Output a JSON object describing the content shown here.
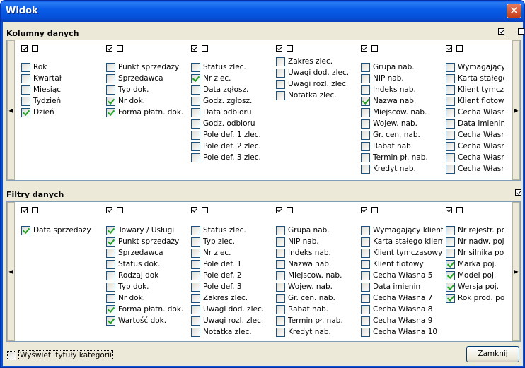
{
  "window": {
    "title": "Widok",
    "close_glyph": "✕"
  },
  "columns_section": {
    "title": "Kolumny danych",
    "header_checks": [
      true,
      false
    ],
    "columns": [
      {
        "header": [
          true,
          false
        ],
        "items": [
          {
            "label": "Rok",
            "checked": false
          },
          {
            "label": "Kwartał",
            "checked": false
          },
          {
            "label": "Miesiąc",
            "checked": false
          },
          {
            "label": "Tydzień",
            "checked": false
          },
          {
            "label": "Dzień",
            "checked": true
          }
        ]
      },
      {
        "header": [
          true,
          false
        ],
        "items": [
          {
            "label": "Punkt sprzedaży",
            "checked": false
          },
          {
            "label": "Sprzedawca",
            "checked": false
          },
          {
            "label": "Typ dok.",
            "checked": false
          },
          {
            "label": "Nr dok.",
            "checked": true
          },
          {
            "label": "Forma płatn. dok.",
            "checked": true
          }
        ]
      },
      {
        "header": [
          true,
          false
        ],
        "items": [
          {
            "label": "Status zlec.",
            "checked": false
          },
          {
            "label": "Nr zlec.",
            "checked": true
          },
          {
            "label": "Data zgłosz.",
            "checked": false
          },
          {
            "label": "Godz. zgłosz.",
            "checked": false
          },
          {
            "label": "Data odbioru",
            "checked": false
          },
          {
            "label": "Godz. odbioru",
            "checked": false
          },
          {
            "label": "Pole def. 1 zlec.",
            "checked": false
          },
          {
            "label": "Pole def. 2 zlec.",
            "checked": false
          },
          {
            "label": "Pole def. 3 zlec.",
            "checked": false
          }
        ]
      },
      {
        "header": [
          true,
          false
        ],
        "items": [
          {
            "label": "Zakres zlec.",
            "checked": false
          },
          {
            "label": "Uwagi dod. zlec.",
            "checked": false
          },
          {
            "label": "Uwagi rozl. zlec.",
            "checked": false
          },
          {
            "label": "Notatka zlec.",
            "checked": false
          }
        ]
      },
      {
        "header": [
          true,
          false
        ],
        "items": [
          {
            "label": "Grupa nab.",
            "checked": false
          },
          {
            "label": "NIP nab.",
            "checked": false
          },
          {
            "label": "Indeks nab.",
            "checked": false
          },
          {
            "label": "Nazwa nab.",
            "checked": true
          },
          {
            "label": "Miejscow. nab.",
            "checked": false
          },
          {
            "label": "Wojew. nab.",
            "checked": false
          },
          {
            "label": "Gr. cen. nab.",
            "checked": false
          },
          {
            "label": "Rabat nab.",
            "checked": false
          },
          {
            "label": "Termin pł. nab.",
            "checked": false
          },
          {
            "label": "Kredyt nab.",
            "checked": false
          }
        ]
      },
      {
        "header": [
          true,
          false
        ],
        "items": [
          {
            "label": "Wymagający kli",
            "checked": false
          },
          {
            "label": "Karta stałego kl",
            "checked": false
          },
          {
            "label": "Klient tymczaso",
            "checked": false
          },
          {
            "label": "Klient flotowy",
            "checked": false
          },
          {
            "label": "Cecha Własna",
            "checked": false
          },
          {
            "label": "Data imienin",
            "checked": false
          },
          {
            "label": "Cecha Własna",
            "checked": false
          },
          {
            "label": "Cecha Własna",
            "checked": false
          },
          {
            "label": "Cecha Własna",
            "checked": false
          },
          {
            "label": "Cecha Własna",
            "checked": false
          }
        ]
      }
    ]
  },
  "filters_section": {
    "title": "Filtry danych",
    "header_checks": [
      true,
      false
    ],
    "columns": [
      {
        "header": [
          true,
          false
        ],
        "items": [
          {
            "label": "Data sprzedaży",
            "checked": true
          }
        ]
      },
      {
        "header": [
          true,
          false
        ],
        "items": [
          {
            "label": "Towary / Usługi",
            "checked": true
          },
          {
            "label": "Punkt sprzedaży",
            "checked": true
          },
          {
            "label": "Sprzedawca",
            "checked": false
          },
          {
            "label": "Status dok.",
            "checked": false
          },
          {
            "label": "Rodzaj dok",
            "checked": false
          },
          {
            "label": "Typ dok.",
            "checked": false
          },
          {
            "label": "Nr dok.",
            "checked": false
          },
          {
            "label": "Forma płatn. dok.",
            "checked": true
          },
          {
            "label": "Wartość dok.",
            "checked": true
          }
        ]
      },
      {
        "header": [
          true,
          false
        ],
        "items": [
          {
            "label": "Status zlec.",
            "checked": false
          },
          {
            "label": "Typ zlec.",
            "checked": false
          },
          {
            "label": "Nr zlec.",
            "checked": false
          },
          {
            "label": "Pole def. 1",
            "checked": false
          },
          {
            "label": "Pole def. 2",
            "checked": false
          },
          {
            "label": "Pole def. 3",
            "checked": false
          },
          {
            "label": "Zakres zlec.",
            "checked": false
          },
          {
            "label": "Uwagi dod. zlec.",
            "checked": false
          },
          {
            "label": "Uwagi rozl. zlec.",
            "checked": false
          },
          {
            "label": "Notatka zlec.",
            "checked": false
          }
        ]
      },
      {
        "header": [
          true,
          false
        ],
        "items": [
          {
            "label": "Grupa nab.",
            "checked": false
          },
          {
            "label": "NIP nab.",
            "checked": false
          },
          {
            "label": "Indeks nab.",
            "checked": false
          },
          {
            "label": "Nazwa nab.",
            "checked": false
          },
          {
            "label": "Miejscow. nab.",
            "checked": false
          },
          {
            "label": "Wojew. nab.",
            "checked": false
          },
          {
            "label": "Gr. cen. nab.",
            "checked": false
          },
          {
            "label": "Rabat nab.",
            "checked": false
          },
          {
            "label": "Termin pł. nab.",
            "checked": false
          },
          {
            "label": "Kredyt nab.",
            "checked": false
          }
        ]
      },
      {
        "header": [
          true,
          false
        ],
        "items": [
          {
            "label": "Wymagający klient",
            "checked": false
          },
          {
            "label": "Karta stałego klienta",
            "checked": false
          },
          {
            "label": "Klient tymczasowy",
            "checked": false
          },
          {
            "label": "Klient flotowy",
            "checked": false
          },
          {
            "label": "Cecha Własna 5",
            "checked": false
          },
          {
            "label": "Data imienin",
            "checked": false
          },
          {
            "label": "Cecha Własna 7",
            "checked": false
          },
          {
            "label": "Cecha Własna 8",
            "checked": false
          },
          {
            "label": "Cecha Własna 9",
            "checked": false
          },
          {
            "label": "Cecha Własna 10",
            "checked": false
          }
        ]
      },
      {
        "header": [
          true,
          false
        ],
        "items": [
          {
            "label": "Nr rejestr. poj.",
            "checked": false
          },
          {
            "label": "Nr nadw. poj.",
            "checked": false
          },
          {
            "label": "Nr silnika poj.",
            "checked": false
          },
          {
            "label": "Marka poj.",
            "checked": true
          },
          {
            "label": "Model poj.",
            "checked": true
          },
          {
            "label": "Wersja poj.",
            "checked": true
          },
          {
            "label": "Rok prod. poj.",
            "checked": true
          }
        ]
      }
    ]
  },
  "footer": {
    "show_category_titles_label": "Wyświetl tytuły kategorii",
    "show_category_titles_checked": false,
    "close_label": "Zamknij"
  },
  "nav": {
    "left_glyph": "◀",
    "right_glyph": "▶"
  }
}
